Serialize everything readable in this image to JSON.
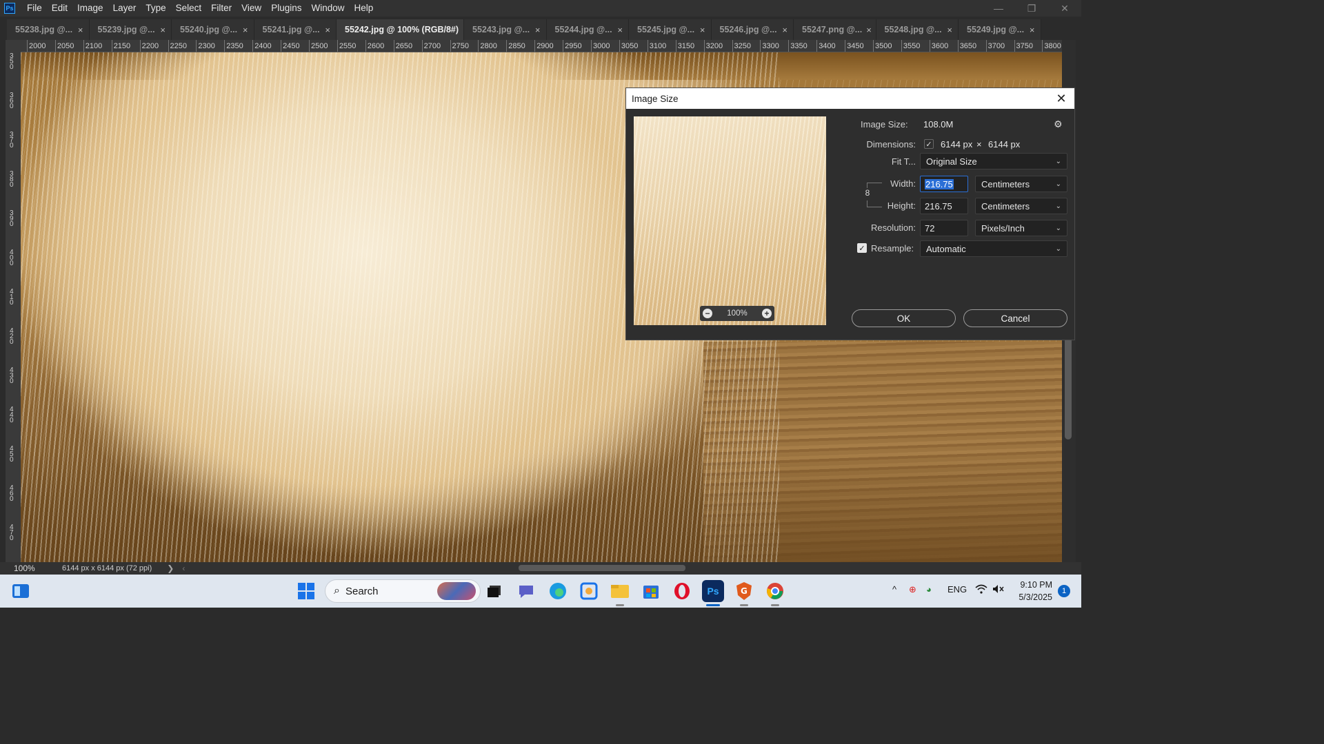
{
  "app": {
    "logo": "Ps"
  },
  "menu": [
    "File",
    "Edit",
    "Image",
    "Layer",
    "Type",
    "Select",
    "Filter",
    "View",
    "Plugins",
    "Window",
    "Help"
  ],
  "window_controls": {
    "minimize": "—",
    "restore": "❐",
    "close": "✕"
  },
  "tabs": [
    {
      "label": "55238.jpg @...",
      "active": false
    },
    {
      "label": "55239.jpg @...",
      "active": false
    },
    {
      "label": "55240.jpg @...",
      "active": false
    },
    {
      "label": "55241.jpg @...",
      "active": false
    },
    {
      "label": "55242.jpg @ 100% (RGB/8#)",
      "active": true
    },
    {
      "label": "55243.jpg @...",
      "active": false
    },
    {
      "label": "55244.jpg @...",
      "active": false
    },
    {
      "label": "55245.jpg @...",
      "active": false
    },
    {
      "label": "55246.jpg @...",
      "active": false
    },
    {
      "label": "55247.png @...",
      "active": false
    },
    {
      "label": "55248.jpg @...",
      "active": false
    },
    {
      "label": "55249.jpg @...",
      "active": false
    }
  ],
  "tab_close": "×",
  "ruler_top": [
    "2000",
    "2050",
    "2100",
    "2150",
    "2200",
    "2250",
    "2300",
    "2350",
    "2400",
    "2450",
    "2500",
    "2550",
    "2600",
    "2650",
    "2700",
    "2750",
    "2800",
    "2850",
    "2900",
    "2950",
    "3000",
    "3050",
    "3100",
    "3150",
    "3200",
    "3250",
    "3300",
    "3350",
    "3400",
    "3450",
    "3500",
    "3550",
    "3600",
    "3650",
    "3700",
    "3750",
    "3800"
  ],
  "ruler_left": [
    "3 5 0",
    "3 6 0",
    "3 7 0",
    "3 8 0",
    "3 9 0",
    "4 0 0",
    "4 1 0",
    "4 2 0",
    "4 3 0",
    "4 4 0",
    "4 5 0",
    "4 6 0",
    "4 7 0"
  ],
  "status": {
    "zoom": "100%",
    "doc_info": "6144 px x 6144 px (72 ppi)",
    "arrow": "❯",
    "scroll_left": "‹"
  },
  "dialog": {
    "title": "Image Size",
    "close": "✕",
    "preview_zoom": "100%",
    "preview_minus": "−",
    "preview_plus": "+",
    "gear": "⚙",
    "image_size_label": "Image Size:",
    "image_size_value": "108.0M",
    "dimensions_label": "Dimensions:",
    "dimensions_check": "✓",
    "dim_width": "6144 px",
    "dim_times": "×",
    "dim_height": "6144 px",
    "fit_label": "Fit T...",
    "fit_value": "Original Size",
    "width_label": "Width:",
    "width_value": "216.75",
    "width_unit": "Centimeters",
    "height_label": "Height:",
    "height_value": "216.75",
    "height_unit": "Centimeters",
    "resolution_label": "Resolution:",
    "resolution_value": "72",
    "resolution_unit": "Pixels/Inch",
    "resample_check": "✓",
    "resample_label": "Resample:",
    "resample_value": "Automatic",
    "chevron": "⌄",
    "link_icon": "8",
    "ok": "OK",
    "cancel": "Cancel"
  },
  "taskbar": {
    "search_placeholder": "Search",
    "search_icon": "⌕",
    "tray_up": "^",
    "tray_lang": "ENG",
    "tray_wifi": "wifi-icon",
    "tray_volume": "volume-muted-icon",
    "time": "9:10 PM",
    "date": "5/3/2025",
    "notification_count": "1"
  },
  "colors": {
    "accent": "#2b6fd6",
    "ps_blue": "#31a8ff",
    "taskbar_bg": "#dfe6ef"
  }
}
